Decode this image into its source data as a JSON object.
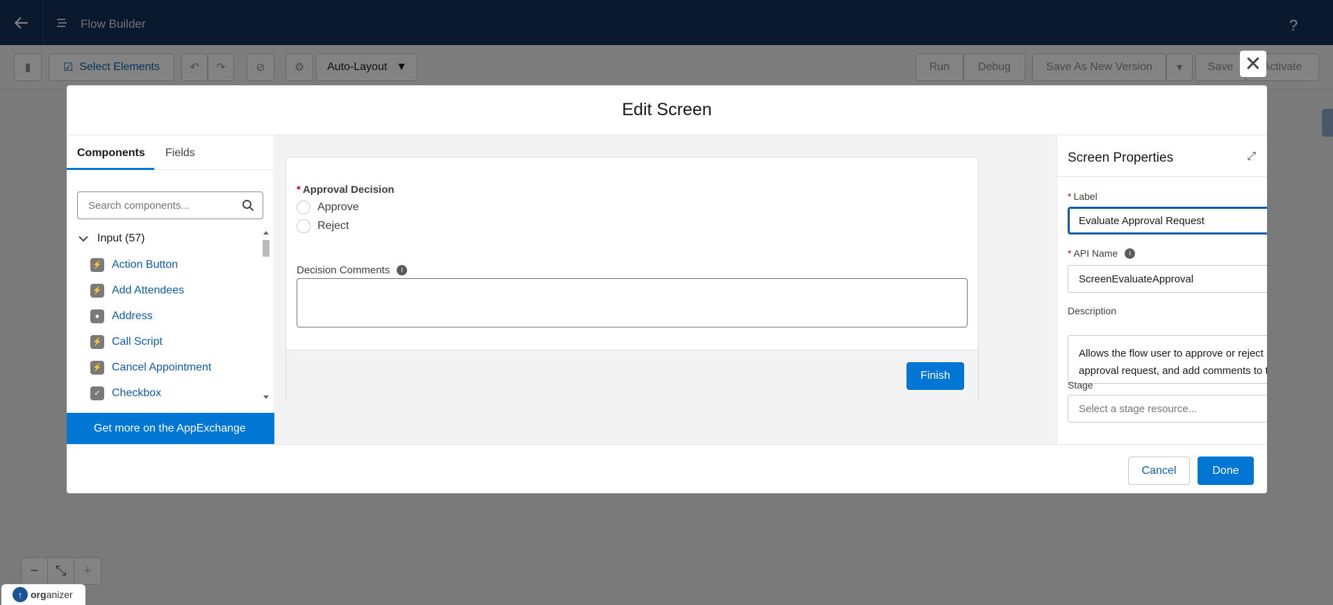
{
  "header": {
    "title": "Flow Builder",
    "help": "?"
  },
  "toolbar": {
    "select_elements": "Select Elements",
    "layout_select": "Auto-Layout",
    "run": "Run",
    "debug": "Debug",
    "save_as_new": "Save As New Version",
    "save": "Save",
    "activate": "Activate"
  },
  "modal": {
    "title": "Edit Screen",
    "palette": {
      "tabs": [
        "Components",
        "Fields"
      ],
      "search_placeholder": "Search components...",
      "category": "Input (57)",
      "components": [
        "Action Button",
        "Add Attendees",
        "Address",
        "Call Script",
        "Cancel Appointment",
        "Checkbox"
      ],
      "appexchange": "Get more on the AppExchange"
    },
    "preview": {
      "radio_label": "Approval Decision",
      "options": [
        "Approve",
        "Reject"
      ],
      "comments_label": "Decision Comments",
      "finish": "Finish"
    },
    "properties": {
      "title": "Screen Properties",
      "label_label": "Label",
      "label_value": "Evaluate Approval Request",
      "api_label": "API Name",
      "api_value": "ScreenEvaluateApproval",
      "description_label": "Description",
      "description_value": "Allows the flow user to approve or reject an approval request, and add comments to the decision.",
      "stage_label": "Stage",
      "stage_placeholder": "Select a stage resource..."
    },
    "footer": {
      "cancel": "Cancel",
      "done": "Done"
    }
  },
  "badge": {
    "org": "org",
    "anizer": "anizer"
  },
  "colors": {
    "brand_blue": "#0176d3",
    "header_navy": "#0e2a54",
    "link_blue": "#0b5cab",
    "required_red": "#ba0517"
  }
}
